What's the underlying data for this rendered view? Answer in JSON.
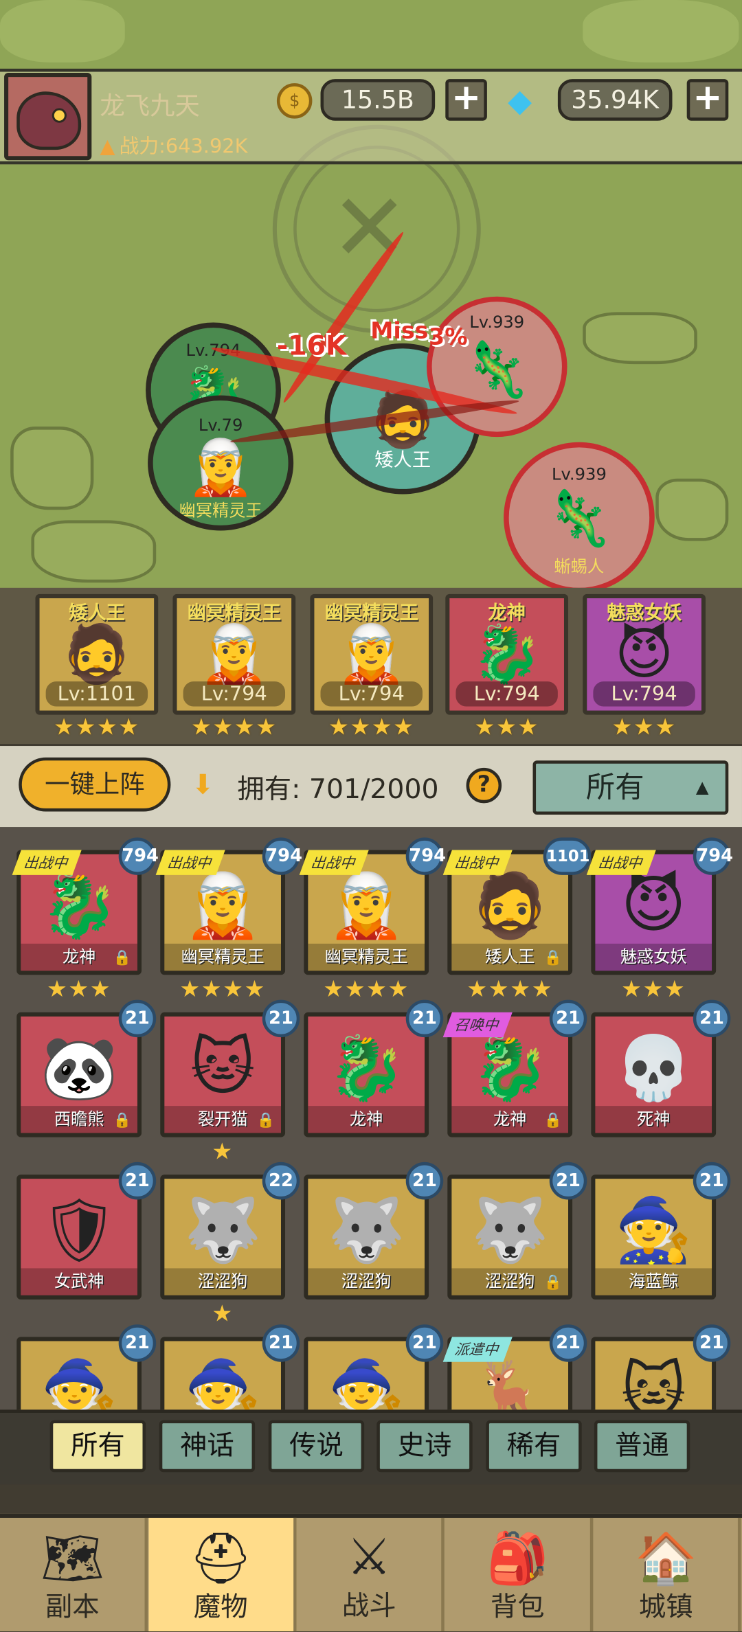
{
  "player": {
    "name": "龙飞九天",
    "power_label": "战力:643.92K",
    "gold": "15.5B",
    "gems": "35.94K",
    "plus": "+"
  },
  "battle": {
    "units": [
      {
        "level": "Lv.794",
        "name": "",
        "color": "#4b8a4f"
      },
      {
        "level": "Lv.79",
        "name": "幽冥精灵王",
        "color": "#4b8a4f"
      },
      {
        "level": "",
        "name": "矮人王",
        "color": "#5fae9a"
      },
      {
        "level": "Lv.939",
        "name": "蜥蜴人",
        "color": "#c98b80"
      },
      {
        "level": "Lv.939",
        "name": "蜥蜴人",
        "color": "#c98b80"
      }
    ],
    "damage_text": "-16K",
    "miss_text": "Miss",
    "percent_text": "3%"
  },
  "team": [
    {
      "name": "矮人王",
      "level": "Lv:1101",
      "stars": "★★★★",
      "bg": "#c9a64d",
      "icon": "🧔"
    },
    {
      "name": "幽冥精灵王",
      "level": "Lv:794",
      "stars": "★★★★",
      "bg": "#c9a64d",
      "icon": "🧝"
    },
    {
      "name": "幽冥精灵王",
      "level": "Lv:794",
      "stars": "★★★★",
      "bg": "#c9a64d",
      "icon": "🧝"
    },
    {
      "name": "龙神",
      "level": "Lv:794",
      "stars": "★★★",
      "bg": "#c44e5a",
      "icon": "🐉"
    },
    {
      "name": "魅惑女妖",
      "level": "Lv:794",
      "stars": "★★★",
      "bg": "#a84ea8",
      "icon": "😈"
    }
  ],
  "controls": {
    "one_key_deploy": "一键上阵",
    "owned": "拥有: 701/2000",
    "help": "?",
    "filter": "所有",
    "filter_arrow": "▲"
  },
  "monsters": [
    {
      "name": "龙神",
      "level": "794",
      "badge": "出战中",
      "badge_color": "#f6e23a",
      "lock": true,
      "stars": "★★★",
      "bg": "#c44e5a",
      "icon": "🐉"
    },
    {
      "name": "幽冥精灵王",
      "level": "794",
      "badge": "出战中",
      "badge_color": "#f6e23a",
      "lock": false,
      "stars": "★★★★",
      "bg": "#c9a64d",
      "icon": "🧝"
    },
    {
      "name": "幽冥精灵王",
      "level": "794",
      "badge": "出战中",
      "badge_color": "#f6e23a",
      "lock": false,
      "stars": "★★★★",
      "bg": "#c9a64d",
      "icon": "🧝"
    },
    {
      "name": "矮人王",
      "level": "1101",
      "badge": "出战中",
      "badge_color": "#f6e23a",
      "lock": true,
      "stars": "★★★★",
      "bg": "#c9a64d",
      "icon": "🧔"
    },
    {
      "name": "魅惑女妖",
      "level": "794",
      "badge": "出战中",
      "badge_color": "#f6e23a",
      "lock": false,
      "stars": "★★★",
      "bg": "#a84ea8",
      "icon": "😈"
    },
    {
      "name": "西瞻熊",
      "level": "21",
      "badge": "",
      "badge_color": "",
      "lock": true,
      "stars": "",
      "bg": "#c44e5a",
      "icon": "🐼"
    },
    {
      "name": "裂开猫",
      "level": "21",
      "badge": "",
      "badge_color": "",
      "lock": true,
      "stars": "★",
      "bg": "#c44e5a",
      "icon": "🐱"
    },
    {
      "name": "龙神",
      "level": "21",
      "badge": "",
      "badge_color": "",
      "lock": false,
      "stars": "",
      "bg": "#c44e5a",
      "icon": "🐉"
    },
    {
      "name": "龙神",
      "level": "21",
      "badge": "召唤中",
      "badge_color": "#e05ce0",
      "lock": true,
      "stars": "",
      "bg": "#c44e5a",
      "icon": "🐉"
    },
    {
      "name": "死神",
      "level": "21",
      "badge": "",
      "badge_color": "",
      "lock": false,
      "stars": "",
      "bg": "#c44e5a",
      "icon": "💀"
    },
    {
      "name": "女武神",
      "level": "21",
      "badge": "",
      "badge_color": "",
      "lock": false,
      "stars": "",
      "bg": "#c44e5a",
      "icon": "🛡"
    },
    {
      "name": "涩涩狗",
      "level": "22",
      "badge": "",
      "badge_color": "",
      "lock": false,
      "stars": "★",
      "bg": "#c9a64d",
      "icon": "🐺"
    },
    {
      "name": "涩涩狗",
      "level": "21",
      "badge": "",
      "badge_color": "",
      "lock": false,
      "stars": "",
      "bg": "#c9a64d",
      "icon": "🐺"
    },
    {
      "name": "涩涩狗",
      "level": "21",
      "badge": "",
      "badge_color": "",
      "lock": true,
      "stars": "",
      "bg": "#c9a64d",
      "icon": "🐺"
    },
    {
      "name": "海蓝鲸",
      "level": "21",
      "badge": "",
      "badge_color": "",
      "lock": false,
      "stars": "",
      "bg": "#c9a64d",
      "icon": "🧙"
    },
    {
      "name": "",
      "level": "21",
      "badge": "",
      "badge_color": "",
      "lock": false,
      "stars": "",
      "bg": "#c9a64d",
      "icon": "🧙"
    },
    {
      "name": "",
      "level": "21",
      "badge": "",
      "badge_color": "",
      "lock": false,
      "stars": "",
      "bg": "#c9a64d",
      "icon": "🧙"
    },
    {
      "name": "",
      "level": "21",
      "badge": "",
      "badge_color": "",
      "lock": false,
      "stars": "",
      "bg": "#c9a64d",
      "icon": "🧙"
    },
    {
      "name": "",
      "level": "21",
      "badge": "派遣中",
      "badge_color": "#8ee6e0",
      "lock": false,
      "stars": "",
      "bg": "#c9a64d",
      "icon": "🦌"
    },
    {
      "name": "",
      "level": "21",
      "badge": "",
      "badge_color": "",
      "lock": false,
      "stars": "",
      "bg": "#c9a64d",
      "icon": "🐱"
    }
  ],
  "rarity_tabs": [
    "所有",
    "神话",
    "传说",
    "史诗",
    "稀有",
    "普通"
  ],
  "nav": [
    {
      "label": "副本",
      "icon": "🗺"
    },
    {
      "label": "魔物",
      "icon": "⛑"
    },
    {
      "label": "战斗",
      "icon": "⚔"
    },
    {
      "label": "背包",
      "icon": "🎒"
    },
    {
      "label": "城镇",
      "icon": "🏠"
    }
  ]
}
